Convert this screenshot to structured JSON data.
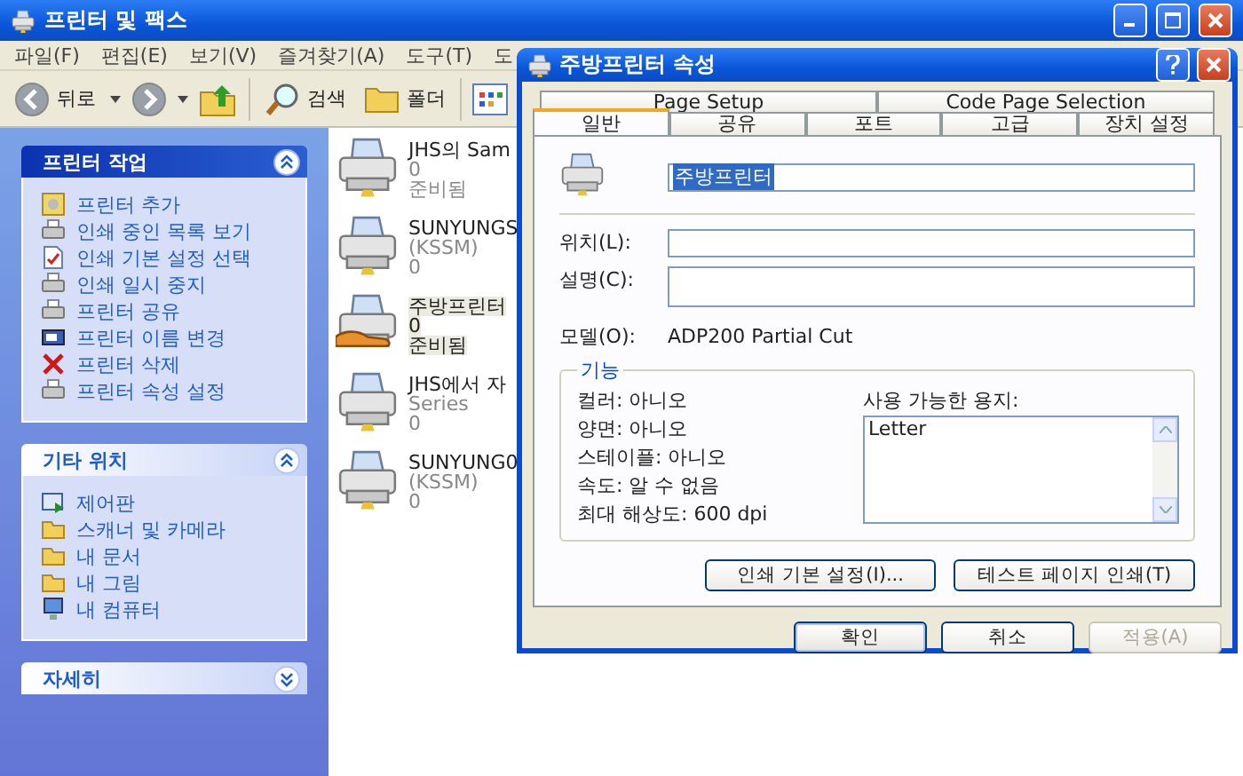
{
  "window": {
    "title": "프린터 및 팩스"
  },
  "menu": [
    "파일(F)",
    "편집(E)",
    "보기(V)",
    "즐겨찾기(A)",
    "도구(T)",
    "도"
  ],
  "toolbar": {
    "back": "뒤로",
    "search": "검색",
    "folders": "폴더"
  },
  "sidebar": [
    {
      "title": "프린터 작업",
      "kind": "primary",
      "expanded": true,
      "items": [
        "프린터 추가",
        "인쇄 중인 목록 보기",
        "인쇄 기본 설정 선택",
        "인쇄 일시 중지",
        "프린터 공유",
        "프린터 이름 변경",
        "프린터 삭제",
        "프린터 속성 설정"
      ]
    },
    {
      "title": "기타 위치",
      "kind": "secondary",
      "expanded": true,
      "items": [
        "제어판",
        "스캐너 및 카메라",
        "내 문서",
        "내 그림",
        "내 컴퓨터"
      ]
    },
    {
      "title": "자세히",
      "kind": "secondary",
      "expanded": false
    }
  ],
  "printers": [
    {
      "lines": [
        "JHS의 Sam",
        "0",
        "준비됨"
      ],
      "selected": false,
      "shared": false
    },
    {
      "lines": [
        "SUNYUNGS",
        "(KSSM)",
        "0"
      ],
      "selected": false,
      "shared": false
    },
    {
      "lines": [
        "주방프린터",
        "0",
        "준비됨"
      ],
      "selected": true,
      "shared": true
    },
    {
      "lines": [
        "JHS에서 자",
        "Series",
        "0"
      ],
      "selected": false,
      "shared": false
    },
    {
      "lines": [
        "SUNYUNG0",
        "(KSSM)",
        "0"
      ],
      "selected": false,
      "shared": false
    }
  ],
  "dialog": {
    "title": "주방프린터 속성",
    "tabs_top": [
      {
        "label": "Page Setup",
        "selected": false
      },
      {
        "label": "Code Page Selection",
        "selected": false
      }
    ],
    "tabs": [
      {
        "label": "일반",
        "selected": true
      },
      {
        "label": "공유",
        "selected": false
      },
      {
        "label": "포트",
        "selected": false
      },
      {
        "label": "고급",
        "selected": false
      },
      {
        "label": "장치 설정",
        "selected": false
      }
    ],
    "name": {
      "value": "주방프린터",
      "highlighted": true
    },
    "fields": [
      {
        "label": "위치(L):",
        "kind": "line"
      },
      {
        "label": "설명(C):",
        "kind": "area"
      }
    ],
    "model": {
      "label": "모델(O):",
      "value": "ADP200 Partial Cut"
    },
    "features": {
      "title": "기능",
      "items": [
        "컬러: 아니오",
        "양면: 아니오",
        "스테이플: 아니오",
        "속도: 알 수 없음",
        "최대 해상도: 600 dpi"
      ],
      "paper_label": "사용 가능한 용지:",
      "paper": [
        "Letter"
      ]
    },
    "actions": [
      "인쇄 기본 설정(I)...",
      "테스트 페이지 인쇄(T)"
    ],
    "buttons": [
      {
        "label": "확인",
        "default": true,
        "disabled": false
      },
      {
        "label": "취소",
        "default": false,
        "disabled": false
      },
      {
        "label": "적용(A)",
        "default": false,
        "disabled": true
      }
    ]
  }
}
